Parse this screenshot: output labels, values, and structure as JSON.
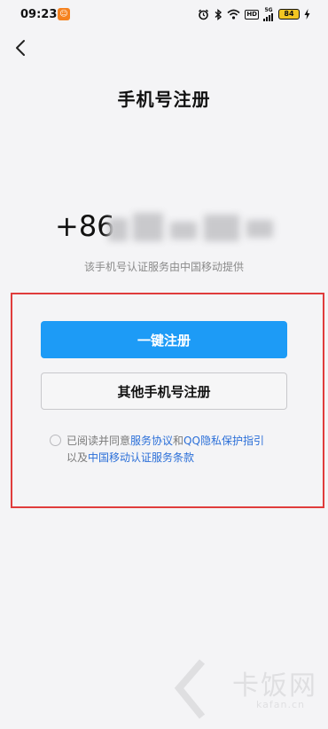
{
  "status_bar": {
    "time": "09:23",
    "hd_label": "HD",
    "signal_label": "5G",
    "battery_level": "84"
  },
  "header": {
    "back_icon": "chevron-left-icon",
    "title": "手机号注册"
  },
  "phone": {
    "prefix": "+86",
    "note": "该手机号认证服务由中国移动提供"
  },
  "actions": {
    "one_click_register": "一键注册",
    "other_phone_register": "其他手机号注册"
  },
  "agreement": {
    "prefix": "已阅读并同意",
    "service_agreement": "服务协议",
    "and": "和",
    "privacy_guide": "QQ隐私保护指引",
    "and_also": "以及",
    "cmcc_terms": "中国移动认证服务条款",
    "checked": false
  },
  "watermark": {
    "brand": "卡饭网",
    "sub": "kafan.cn"
  },
  "colors": {
    "primary": "#1d9bf6",
    "link": "#2b6fd8",
    "highlight": "#e03c3c",
    "background": "#f4f4f6"
  }
}
